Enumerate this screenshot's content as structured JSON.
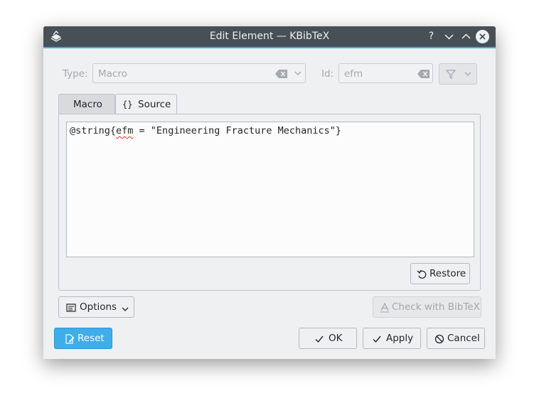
{
  "window": {
    "title": "Edit Element — KBibTeX"
  },
  "titlebar": {
    "help": "?",
    "minimize": "⌄",
    "maximize": "⌃"
  },
  "form": {
    "type_label": "Type:",
    "type_value": "Macro",
    "id_label": "Id:",
    "id_value": "efm"
  },
  "tabs": [
    {
      "label": "Macro"
    },
    {
      "label": "Source",
      "icon": "{}"
    }
  ],
  "source": {
    "prefix": "@string{",
    "key": "efm",
    "suffix": " = \"Engineering Fracture Mechanics\"}"
  },
  "buttons": {
    "restore": "Restore",
    "options": "Options",
    "check": "Check with BibTeX",
    "reset": "Reset",
    "ok": "OK",
    "apply": "Apply",
    "cancel": "Cancel"
  },
  "colors": {
    "accent": "#3daee9",
    "titlebar": "#475057",
    "window_bg": "#eff0f1"
  }
}
